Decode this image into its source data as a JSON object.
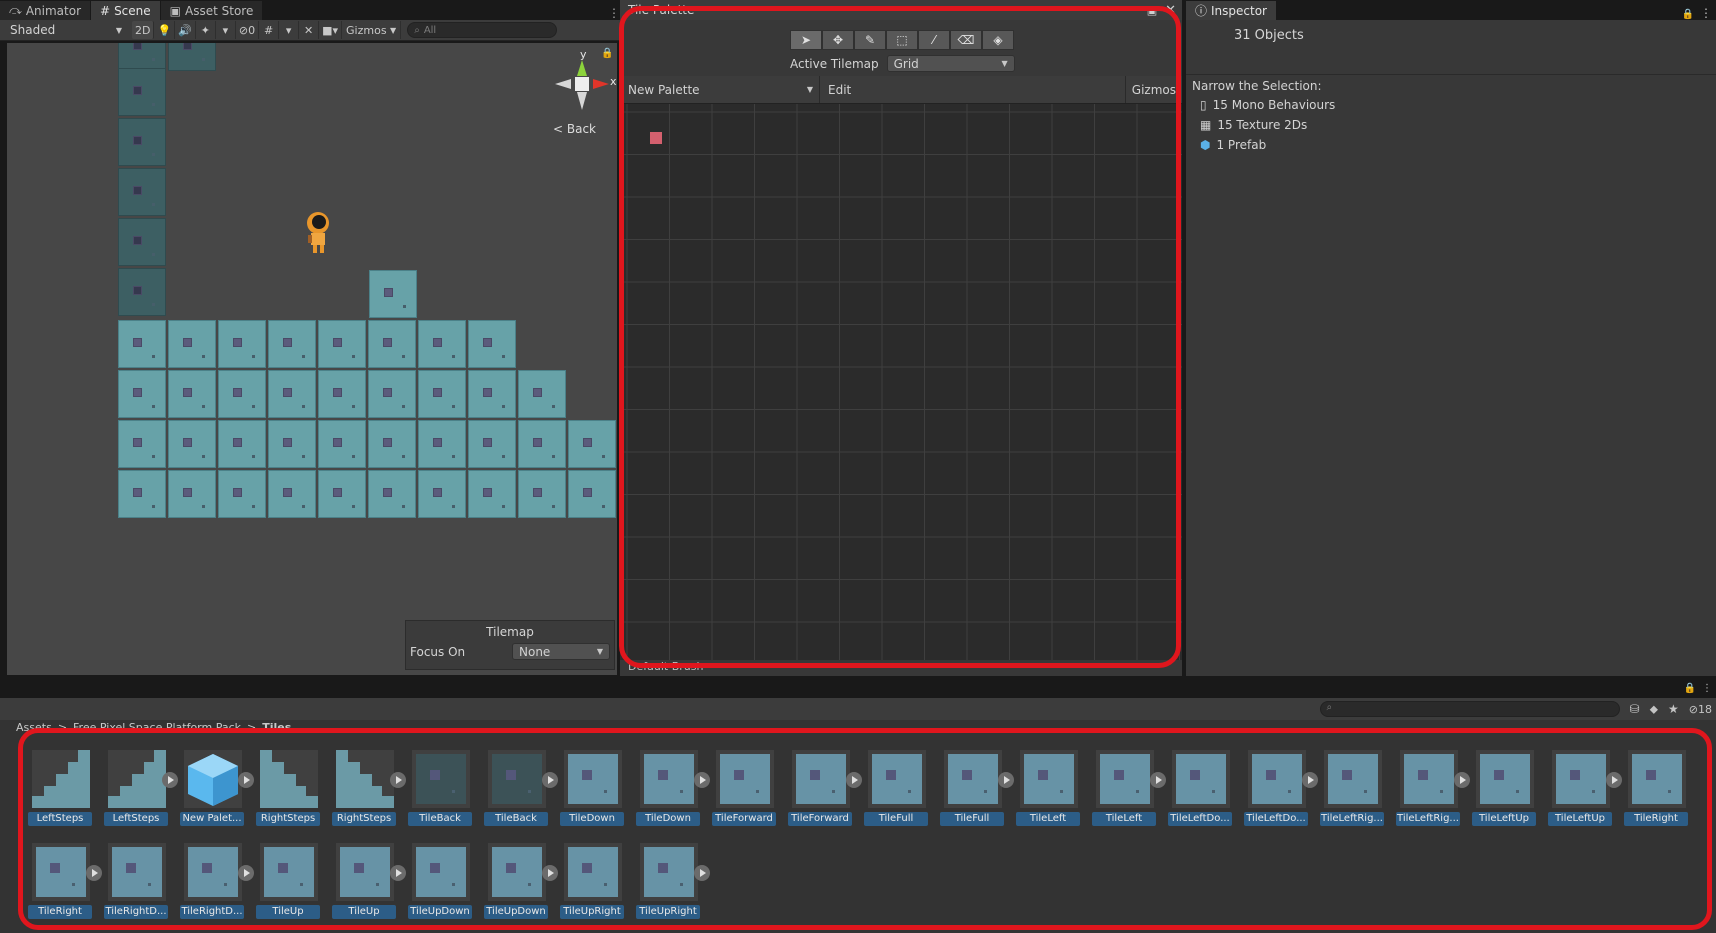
{
  "scene_tabs": [
    {
      "label": "Animator",
      "icon": "animator-icon"
    },
    {
      "label": "Scene",
      "icon": "scene-grid-icon"
    },
    {
      "label": "Asset Store",
      "icon": "store-icon"
    }
  ],
  "scene_toolbar": {
    "shading_mode": "Shaded",
    "mode_2d": "2D",
    "hidden_count": "0",
    "gizmos": "Gizmos",
    "search_placeholder": "All"
  },
  "scene_gizmo": {
    "back_label": "Back",
    "axis_y": "y",
    "axis_x": "x"
  },
  "tilemap_overlay": {
    "title": "Tilemap",
    "focus_label": "Focus On",
    "focus_value": "None"
  },
  "tile_palette": {
    "title": "Tile Palette",
    "active_tilemap_label": "Active Tilemap",
    "active_tilemap_value": "Grid",
    "palette_name": "New Palette",
    "edit_label": "Edit",
    "gizmos_label": "Gizmos",
    "footer_label": "Default Brush",
    "tools": [
      "select-tool-icon",
      "move-tool-icon",
      "paint-brush-icon",
      "box-fill-icon",
      "picker-icon",
      "eraser-icon",
      "fill-bucket-icon"
    ]
  },
  "inspector": {
    "title": "Inspector",
    "object_count": "31 Objects",
    "narrow_label": "Narrow the Selection:",
    "items": [
      {
        "label": "15 Mono Behaviours",
        "icon": "script-icon"
      },
      {
        "label": "15 Texture 2Ds",
        "icon": "texture-icon"
      },
      {
        "label": "1 Prefab",
        "icon": "prefab-icon"
      }
    ]
  },
  "project": {
    "breadcrumb": [
      "Assets",
      "Free Pixel Space Platform Pack",
      "Tiles"
    ],
    "hidden_count": "18",
    "assets": [
      {
        "label": "LeftSteps",
        "kind": "steps-left",
        "play": false
      },
      {
        "label": "LeftSteps",
        "kind": "steps-left",
        "play": true
      },
      {
        "label": "New Palet...",
        "kind": "prefab",
        "play": true
      },
      {
        "label": "RightSteps",
        "kind": "steps-right",
        "play": false
      },
      {
        "label": "RightSteps",
        "kind": "steps-right",
        "play": true
      },
      {
        "label": "TileBack",
        "kind": "dark",
        "play": false
      },
      {
        "label": "TileBack",
        "kind": "dark",
        "play": true
      },
      {
        "label": "TileDown",
        "kind": "tile",
        "play": false
      },
      {
        "label": "TileDown",
        "kind": "tile",
        "play": true
      },
      {
        "label": "TileForward",
        "kind": "tile",
        "play": false
      },
      {
        "label": "TileForward",
        "kind": "tile",
        "play": true
      },
      {
        "label": "TileFull",
        "kind": "tile",
        "play": false
      },
      {
        "label": "TileFull",
        "kind": "tile",
        "play": true
      },
      {
        "label": "TileLeft",
        "kind": "tile",
        "play": false
      },
      {
        "label": "TileLeft",
        "kind": "tile",
        "play": true
      },
      {
        "label": "TileLeftDo...",
        "kind": "tile",
        "play": false
      },
      {
        "label": "TileLeftDo...",
        "kind": "tile",
        "play": true
      },
      {
        "label": "TileLeftRig...",
        "kind": "tile",
        "play": false
      },
      {
        "label": "TileLeftRig...",
        "kind": "tile",
        "play": true
      },
      {
        "label": "TileLeftUp",
        "kind": "tile",
        "play": false
      },
      {
        "label": "TileLeftUp",
        "kind": "tile",
        "play": true
      },
      {
        "label": "TileRight",
        "kind": "tile",
        "play": false
      },
      {
        "label": "TileRight",
        "kind": "tile",
        "play": true
      },
      {
        "label": "TileRightD...",
        "kind": "tile",
        "play": false
      },
      {
        "label": "TileRightD...",
        "kind": "tile",
        "play": true
      },
      {
        "label": "TileUp",
        "kind": "tile",
        "play": false
      },
      {
        "label": "TileUp",
        "kind": "tile",
        "play": true
      },
      {
        "label": "TileUpDown",
        "kind": "tile",
        "play": false
      },
      {
        "label": "TileUpDown",
        "kind": "tile",
        "play": true
      },
      {
        "label": "TileUpRight",
        "kind": "tile",
        "play": false
      },
      {
        "label": "TileUpRight",
        "kind": "tile",
        "play": true
      }
    ]
  },
  "colors": {
    "highlight_box": "#e0161d",
    "tile": "#67a2a8",
    "selection": "#2c5d87"
  }
}
